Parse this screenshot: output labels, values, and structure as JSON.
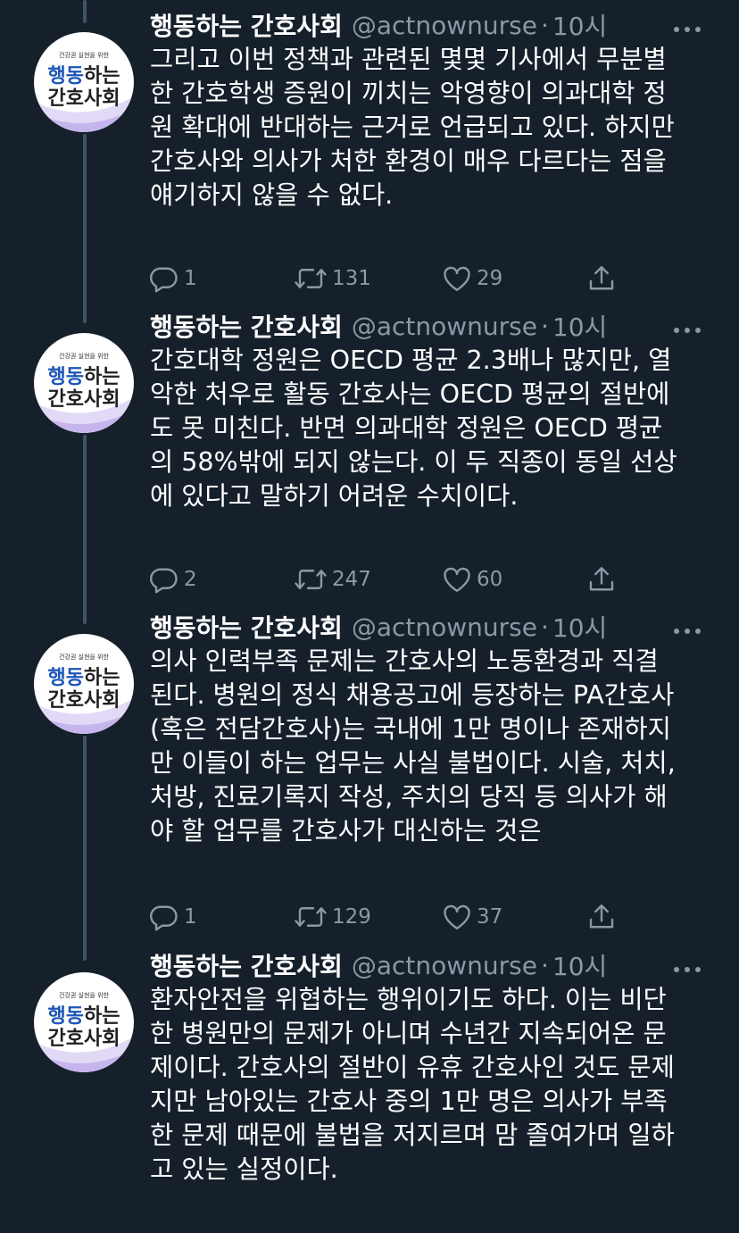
{
  "colors": {
    "background": "#15202b",
    "text_primary": "#ffffff",
    "text_secondary": "#8b98a5",
    "thread_line": "#3d5466",
    "avatar_brand_blue": "#1d56b8"
  },
  "icons": {
    "reply": "reply-icon",
    "retweet": "retweet-icon",
    "like": "heart-icon",
    "share": "share-icon",
    "more": "more-icon"
  },
  "avatar_logo": {
    "tagline": "건강권 실현을 위한",
    "word_blue": "행동",
    "word_dark1": "하는",
    "word_dark2": "간호사회"
  },
  "tweets": [
    {
      "display_name": "행동하는 간호사회",
      "handle": "@actnownurse",
      "separator": "·",
      "time": "10시",
      "text": "그리고 이번 정책과 관련된 몇몇 기사에서 무분별\n한 간호학생 증원이 끼치는 악영향이 의과대학 정\n원 확대에 반대하는 근거로 언급되고 있다. 하지만\n간호사와 의사가 처한 환경이 매우 다르다는 점을\n얘기하지 않을 수 없다.",
      "replies": "1",
      "retweets": "131",
      "likes": "29"
    },
    {
      "display_name": "행동하는 간호사회",
      "handle": "@actnownurse",
      "separator": "·",
      "time": "10시",
      "text": "간호대학 정원은 OECD 평균 2.3배나 많지만, 열\n악한 처우로 활동 간호사는 OECD 평균의 절반에\n도 못 미친다. 반면 의과대학 정원은 OECD 평균\n의 58%밖에 되지 않는다. 이 두 직종이 동일 선상\n에 있다고 말하기 어려운 수치이다.",
      "replies": "2",
      "retweets": "247",
      "likes": "60"
    },
    {
      "display_name": "행동하는 간호사회",
      "handle": "@actnownurse",
      "separator": "·",
      "time": "10시",
      "text": "의사 인력부족 문제는 간호사의 노동환경과 직결\n된다. 병원의 정식 채용공고에 등장하는 PA간호사\n(혹은 전담간호사)는 국내에 1만 명이나 존재하지\n만 이들이 하는 업무는 사실 불법이다. 시술, 처치,\n처방, 진료기록지 작성, 주치의 당직 등 의사가 해\n야 할 업무를 간호사가 대신하는 것은",
      "replies": "1",
      "retweets": "129",
      "likes": "37"
    },
    {
      "display_name": "행동하는 간호사회",
      "handle": "@actnownurse",
      "separator": "·",
      "time": "10시",
      "text": "환자안전을 위협하는 행위이기도 하다. 이는 비단\n한 병원만의 문제가 아니며 수년간 지속되어온 문\n제이다. 간호사의 절반이 유휴 간호사인 것도 문제\n지만 남아있는 간호사 중의 1만 명은 의사가 부족\n한 문제 때문에 불법을 저지르며 맘 졸여가며 일하\n고 있는 실정이다."
    }
  ]
}
